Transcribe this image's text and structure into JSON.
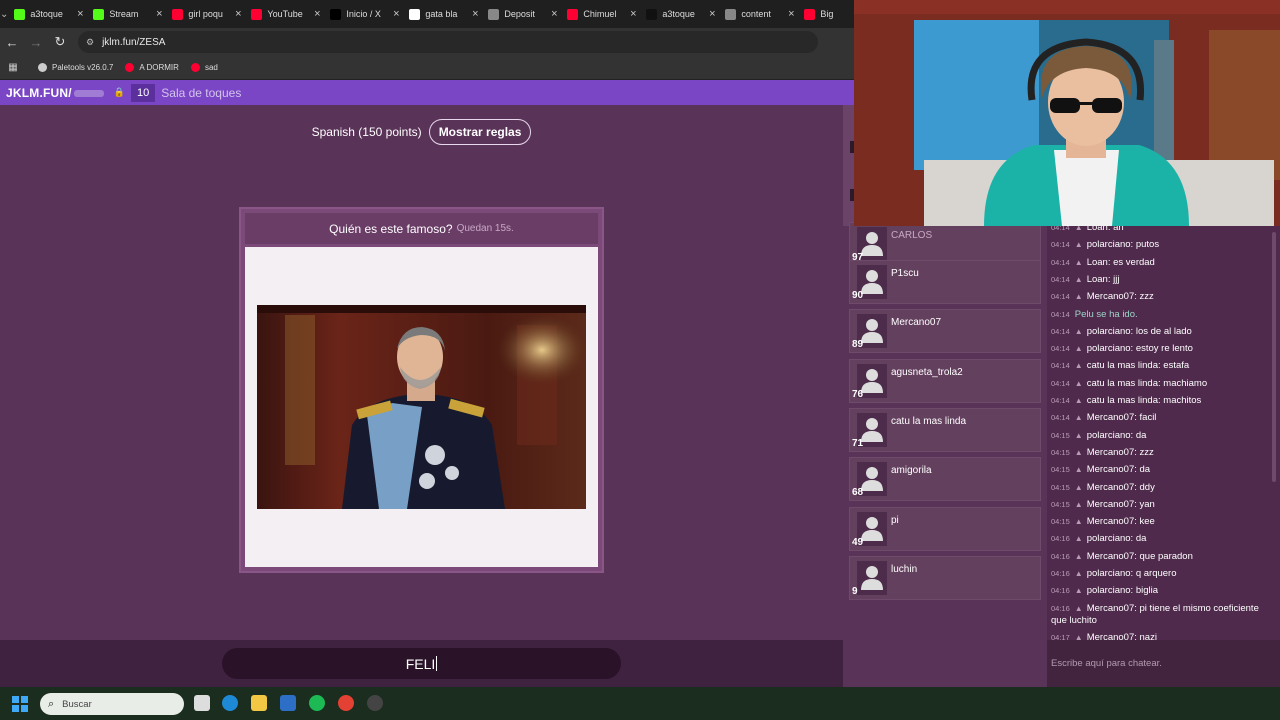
{
  "browser": {
    "tabs": [
      {
        "label": "a3toque",
        "icon": "kick-icon",
        "color": "#53fc18"
      },
      {
        "label": "Stream",
        "icon": "kick-icon",
        "color": "#53fc18"
      },
      {
        "label": "girl poqu",
        "icon": "youtube-icon",
        "color": "#ff0033"
      },
      {
        "label": "YouTube",
        "icon": "youtube-icon",
        "color": "#ff0033"
      },
      {
        "label": "Inicio / X",
        "icon": "x-icon",
        "color": "#000000"
      },
      {
        "label": "gata bla",
        "icon": "google-icon",
        "color": "#ffffff"
      },
      {
        "label": "Deposit",
        "icon": "globe-icon",
        "color": "#888888"
      },
      {
        "label": "Chimuel",
        "icon": "youtube-icon",
        "color": "#ff0033"
      },
      {
        "label": "a3toque",
        "icon": "tiktok-icon",
        "color": "#111111"
      },
      {
        "label": "content",
        "icon": "globe-icon",
        "color": "#888888"
      },
      {
        "label": "Big",
        "icon": "youtube-icon",
        "color": "#ff0033"
      }
    ],
    "url": "jklm.fun/ZESA",
    "bookmarks": [
      {
        "label": "Paletools v26.0.7",
        "color": "#cccccc"
      },
      {
        "label": "A DORMIR",
        "color": "#ff0033"
      },
      {
        "label": "sad",
        "color": "#ff0033"
      }
    ]
  },
  "site": {
    "brand": "JKLM.FUN/",
    "room_count": "10",
    "room_name": "Sala de toques"
  },
  "game": {
    "language": "Spanish (150 points)",
    "rules_button": "Mostrar reglas",
    "question": "Quién es este famoso?",
    "timer": "Quedan 15s.",
    "answer_value": "FELI"
  },
  "players": [
    {
      "name": "CARLOS",
      "score": "97",
      "away": true
    },
    {
      "name": "P1scu",
      "score": "90",
      "away": false
    },
    {
      "name": "Mercano07",
      "score": "89",
      "away": false
    },
    {
      "name": "agusneta_trola2",
      "score": "76",
      "away": false
    },
    {
      "name": "catu la mas linda",
      "score": "71",
      "away": false
    },
    {
      "name": "amigorila",
      "score": "68",
      "away": false
    },
    {
      "name": "pi",
      "score": "49",
      "away": false
    },
    {
      "name": "luchin",
      "score": "9",
      "away": false
    }
  ],
  "chat": {
    "messages": [
      {
        "time": "04:14",
        "user": "Loan",
        "text": "ah"
      },
      {
        "time": "04:14",
        "user": "polarciano",
        "text": "putos"
      },
      {
        "time": "04:14",
        "user": "Loan",
        "text": "es verdad"
      },
      {
        "time": "04:14",
        "user": "Loan",
        "text": "jjj"
      },
      {
        "time": "04:14",
        "user": "Mercano07",
        "text": "zzz"
      },
      {
        "time": "04:14",
        "user": "",
        "text": "Pelu se ha ido.",
        "system": true
      },
      {
        "time": "04:14",
        "user": "polarciano",
        "text": "los de al lado"
      },
      {
        "time": "04:14",
        "user": "polarciano",
        "text": "estoy re lento"
      },
      {
        "time": "04:14",
        "user": "catu la mas linda",
        "text": "estafa"
      },
      {
        "time": "04:14",
        "user": "catu la mas linda",
        "text": "machiamo"
      },
      {
        "time": "04:14",
        "user": "catu la mas linda",
        "text": "machitos"
      },
      {
        "time": "04:14",
        "user": "Mercano07",
        "text": "facil"
      },
      {
        "time": "04:15",
        "user": "polarciano",
        "text": "da"
      },
      {
        "time": "04:15",
        "user": "Mercano07",
        "text": "zzz"
      },
      {
        "time": "04:15",
        "user": "Mercano07",
        "text": "da"
      },
      {
        "time": "04:15",
        "user": "Mercano07",
        "text": "ddy"
      },
      {
        "time": "04:15",
        "user": "Mercano07",
        "text": "yan"
      },
      {
        "time": "04:15",
        "user": "Mercano07",
        "text": "kee"
      },
      {
        "time": "04:16",
        "user": "polarciano",
        "text": "da"
      },
      {
        "time": "04:16",
        "user": "Mercano07",
        "text": "que paradon"
      },
      {
        "time": "04:16",
        "user": "polarciano",
        "text": "q arquero"
      },
      {
        "time": "04:16",
        "user": "polarciano",
        "text": "biglia"
      },
      {
        "time": "04:16",
        "user": "Mercano07",
        "text": "pi tiene el mismo coeficiente que luchito"
      },
      {
        "time": "04:17",
        "user": "Mercano07",
        "text": "nazi"
      }
    ],
    "input_placeholder": "Escribe aquí para chatear."
  },
  "taskbar": {
    "search_placeholder": "Buscar"
  },
  "colors": {
    "site_accent": "#7a46c5",
    "game_bg": "#5a3358",
    "chat_bg": "#4f2a4c"
  }
}
